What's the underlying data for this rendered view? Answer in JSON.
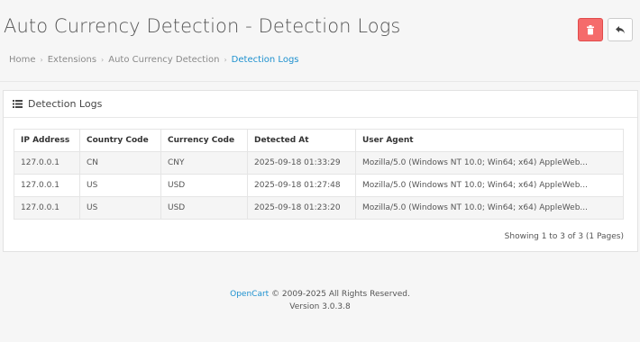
{
  "header": {
    "title": "Auto Currency Detection - Detection Logs",
    "delete_icon": "trash-icon",
    "back_icon": "reply-icon",
    "danger_color": "#f56b6b"
  },
  "breadcrumb": [
    {
      "label": "Home"
    },
    {
      "label": "Extensions"
    },
    {
      "label": "Auto Currency Detection"
    },
    {
      "label": "Detection Logs"
    }
  ],
  "panel": {
    "title": "Detection Logs",
    "icon": "list-icon"
  },
  "table": {
    "columns": [
      "IP Address",
      "Country Code",
      "Currency Code",
      "Detected At",
      "User Agent"
    ],
    "rows": [
      [
        "127.0.0.1",
        "CN",
        "CNY",
        "2025-09-18 01:33:29",
        "Mozilla/5.0 (Windows NT 10.0; Win64; x64) AppleWeb..."
      ],
      [
        "127.0.0.1",
        "US",
        "USD",
        "2025-09-18 01:27:48",
        "Mozilla/5.0 (Windows NT 10.0; Win64; x64) AppleWeb..."
      ],
      [
        "127.0.0.1",
        "US",
        "USD",
        "2025-09-18 01:23:20",
        "Mozilla/5.0 (Windows NT 10.0; Win64; x64) AppleWeb..."
      ]
    ]
  },
  "pagination": {
    "info": "Showing 1 to 3 of 3 (1 Pages)"
  },
  "footer": {
    "brand": "OpenCart",
    "copyright": " © 2009-2025 All Rights Reserved.",
    "version": "Version 3.0.3.8",
    "link_color": "#1e91cf"
  }
}
